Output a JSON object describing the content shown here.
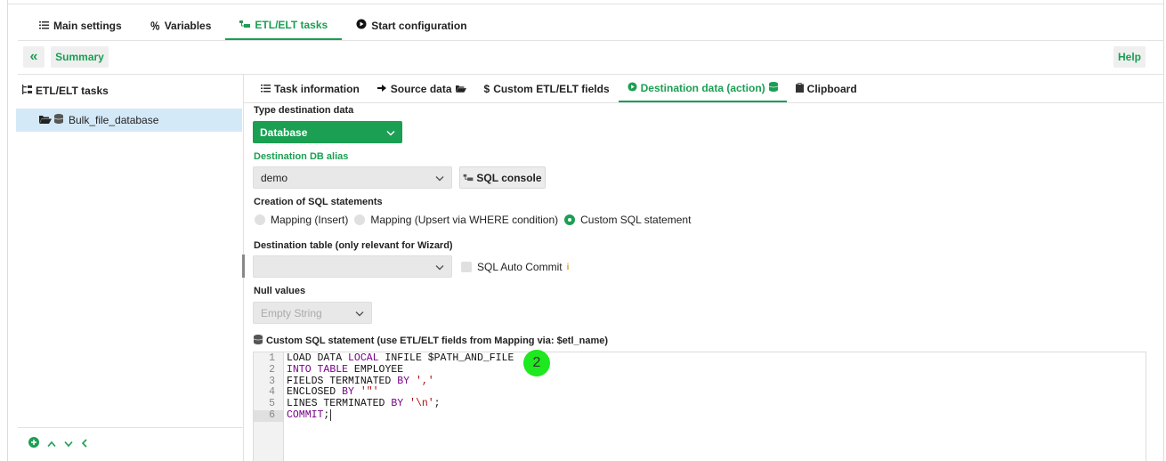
{
  "top_tabs": [
    {
      "label": "Main settings",
      "icon": "list-icon"
    },
    {
      "label": "Variables",
      "icon": "percent-icon"
    },
    {
      "label": "ETL/ELT tasks",
      "icon": "etl-icon"
    },
    {
      "label": "Start configuration",
      "icon": "play-circle-icon"
    }
  ],
  "toolbar": {
    "back_label": "«",
    "summary_label": "Summary",
    "help_label": "Help"
  },
  "tree": {
    "title": "ETL/ELT tasks",
    "items": [
      {
        "label": "Bulk_file_database"
      }
    ]
  },
  "sub_tabs": [
    {
      "label": "Task information"
    },
    {
      "label": "Source data"
    },
    {
      "label": "Custom ETL/ELT fields"
    },
    {
      "label": "Destination data (action)"
    },
    {
      "label": "Clipboard"
    }
  ],
  "form": {
    "type_destination_label": "Type destination data",
    "type_destination_value": "Database",
    "db_alias_label": "Destination DB alias",
    "db_alias_value": "demo",
    "sql_console_label": "SQL console",
    "creation_label": "Creation of SQL statements",
    "radio_options": [
      {
        "label": "Mapping (Insert)",
        "checked": false
      },
      {
        "label": "Mapping (Upsert via WHERE condition)",
        "checked": false
      },
      {
        "label": "Custom SQL statement",
        "checked": true
      }
    ],
    "dest_table_label": "Destination table (only relevant for Wizard)",
    "dest_table_value": "",
    "auto_commit_label": "SQL Auto Commit",
    "null_values_label": "Null values",
    "null_values_value": "Empty String",
    "custom_sql_label": "Custom SQL statement (use ETL/ELT fields from Mapping via: $etl_name)"
  },
  "editor": {
    "line_numbers": [
      "1",
      "2",
      "3",
      "4",
      "5",
      "6"
    ],
    "lines": [
      "LOAD DATA LOCAL INFILE $PATH_AND_FILE",
      "INTO TABLE EMPLOYEE",
      "FIELDS TERMINATED BY ','",
      "ENCLOSED BY '\"'",
      "LINES TERMINATED BY '\\n';",
      "COMMIT;"
    ]
  },
  "marker_label": "2",
  "colors": {
    "accent": "#1a9f53",
    "selection": "#d4e9f7",
    "marker": "#1ee81e"
  }
}
